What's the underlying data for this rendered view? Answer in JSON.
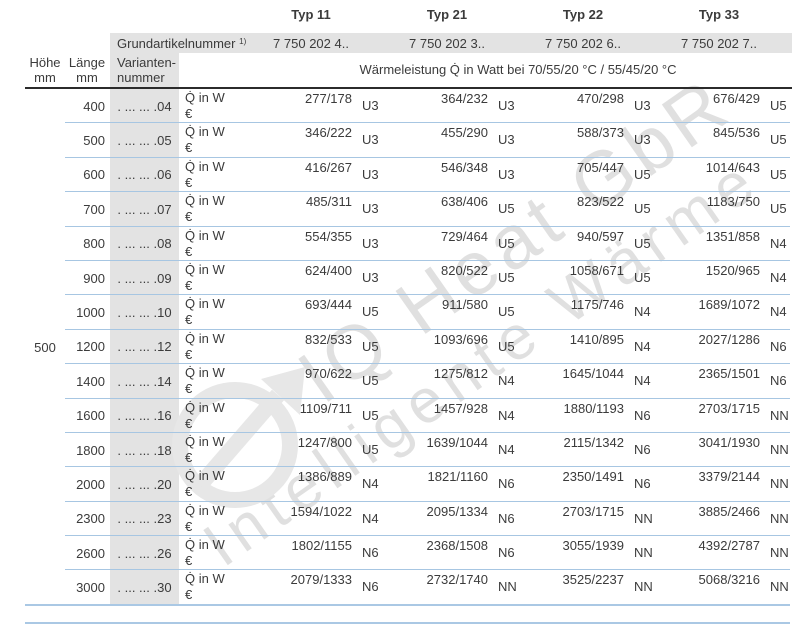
{
  "header": {
    "types": [
      "Typ 11",
      "Typ 21",
      "Typ 22",
      "Typ 33"
    ],
    "grund_label": "Grundartikelnummer",
    "grund_footnote": "1)",
    "grund_numbers": [
      "7 750 202 4..",
      "7 750 202 3..",
      "7 750 202 6..",
      "7 750 202 7.."
    ],
    "hoehe_line1": "Höhe",
    "hoehe_line2": "mm",
    "laenge_line1": "Länge",
    "laenge_line2": "mm",
    "variant_line1": "Varianten-",
    "variant_line2": "nummer",
    "performance": "Wärmeleistung Q̇ in Watt bei 70/55/20 °C / 55/45/20 °C"
  },
  "table": {
    "hoehe_value": "500",
    "q_label": "Q̇ in W",
    "euro_label": "€",
    "rows": [
      {
        "laenge": "400",
        "variant": ". ... ... .04",
        "typ11": {
          "w": "277/178",
          "code": "U3"
        },
        "typ21": {
          "w": "364/232",
          "code": "U3"
        },
        "typ22": {
          "w": "470/298",
          "code": "U3"
        },
        "typ33": {
          "w": "676/429",
          "code": "U5"
        }
      },
      {
        "laenge": "500",
        "variant": ". ... ... .05",
        "typ11": {
          "w": "346/222",
          "code": "U3"
        },
        "typ21": {
          "w": "455/290",
          "code": "U3"
        },
        "typ22": {
          "w": "588/373",
          "code": "U3"
        },
        "typ33": {
          "w": "845/536",
          "code": "U5"
        }
      },
      {
        "laenge": "600",
        "variant": ". ... ... .06",
        "typ11": {
          "w": "416/267",
          "code": "U3"
        },
        "typ21": {
          "w": "546/348",
          "code": "U3"
        },
        "typ22": {
          "w": "705/447",
          "code": "U5"
        },
        "typ33": {
          "w": "1014/643",
          "code": "U5"
        }
      },
      {
        "laenge": "700",
        "variant": ". ... ... .07",
        "typ11": {
          "w": "485/311",
          "code": "U3"
        },
        "typ21": {
          "w": "638/406",
          "code": "U5"
        },
        "typ22": {
          "w": "823/522",
          "code": "U5"
        },
        "typ33": {
          "w": "1183/750",
          "code": "U5"
        }
      },
      {
        "laenge": "800",
        "variant": ". ... ... .08",
        "typ11": {
          "w": "554/355",
          "code": "U3"
        },
        "typ21": {
          "w": "729/464",
          "code": "U5"
        },
        "typ22": {
          "w": "940/597",
          "code": "U5"
        },
        "typ33": {
          "w": "1351/858",
          "code": "N4"
        }
      },
      {
        "laenge": "900",
        "variant": ". ... ... .09",
        "typ11": {
          "w": "624/400",
          "code": "U3"
        },
        "typ21": {
          "w": "820/522",
          "code": "U5"
        },
        "typ22": {
          "w": "1058/671",
          "code": "U5"
        },
        "typ33": {
          "w": "1520/965",
          "code": "N4"
        }
      },
      {
        "laenge": "1000",
        "variant": ". ... ... .10",
        "typ11": {
          "w": "693/444",
          "code": "U5"
        },
        "typ21": {
          "w": "911/580",
          "code": "U5"
        },
        "typ22": {
          "w": "1175/746",
          "code": "N4"
        },
        "typ33": {
          "w": "1689/1072",
          "code": "N4"
        }
      },
      {
        "laenge": "1200",
        "variant": ". ... ... .12",
        "typ11": {
          "w": "832/533",
          "code": "U5"
        },
        "typ21": {
          "w": "1093/696",
          "code": "U5"
        },
        "typ22": {
          "w": "1410/895",
          "code": "N4"
        },
        "typ33": {
          "w": "2027/1286",
          "code": "N6"
        }
      },
      {
        "laenge": "1400",
        "variant": ". ... ... .14",
        "typ11": {
          "w": "970/622",
          "code": "U5"
        },
        "typ21": {
          "w": "1275/812",
          "code": "N4"
        },
        "typ22": {
          "w": "1645/1044",
          "code": "N4"
        },
        "typ33": {
          "w": "2365/1501",
          "code": "N6"
        }
      },
      {
        "laenge": "1600",
        "variant": ". ... ... .16",
        "typ11": {
          "w": "1109/711",
          "code": "U5"
        },
        "typ21": {
          "w": "1457/928",
          "code": "N4"
        },
        "typ22": {
          "w": "1880/1193",
          "code": "N6"
        },
        "typ33": {
          "w": "2703/1715",
          "code": "NN"
        }
      },
      {
        "laenge": "1800",
        "variant": ". ... ... .18",
        "typ11": {
          "w": "1247/800",
          "code": "U5"
        },
        "typ21": {
          "w": "1639/1044",
          "code": "N4"
        },
        "typ22": {
          "w": "2115/1342",
          "code": "N6"
        },
        "typ33": {
          "w": "3041/1930",
          "code": "NN"
        }
      },
      {
        "laenge": "2000",
        "variant": ". ... ... .20",
        "typ11": {
          "w": "1386/889",
          "code": "N4"
        },
        "typ21": {
          "w": "1821/1160",
          "code": "N6"
        },
        "typ22": {
          "w": "2350/1491",
          "code": "N6"
        },
        "typ33": {
          "w": "3379/2144",
          "code": "NN"
        }
      },
      {
        "laenge": "2300",
        "variant": ". ... ... .23",
        "typ11": {
          "w": "1594/1022",
          "code": "N4"
        },
        "typ21": {
          "w": "2095/1334",
          "code": "N6"
        },
        "typ22": {
          "w": "2703/1715",
          "code": "NN"
        },
        "typ33": {
          "w": "3885/2466",
          "code": "NN"
        }
      },
      {
        "laenge": "2600",
        "variant": ". ... ... .26",
        "typ11": {
          "w": "1802/1155",
          "code": "N6"
        },
        "typ21": {
          "w": "2368/1508",
          "code": "N6"
        },
        "typ22": {
          "w": "3055/1939",
          "code": "NN"
        },
        "typ33": {
          "w": "4392/2787",
          "code": "NN"
        }
      },
      {
        "laenge": "3000",
        "variant": ". ... ... .30",
        "typ11": {
          "w": "2079/1333",
          "code": "N6"
        },
        "typ21": {
          "w": "2732/1740",
          "code": "NN"
        },
        "typ22": {
          "w": "3525/2237",
          "code": "NN"
        },
        "typ33": {
          "w": "5068/3216",
          "code": "NN"
        }
      }
    ]
  },
  "watermark": {
    "line1": "IQ Heat GbR",
    "line2": "Intelligente Wärme",
    "logo": "circle-arrow"
  },
  "colors": {
    "header_gray": "#e3e3e3",
    "separator_blue": "#a7c6e2",
    "divider_black": "#2b2b2b",
    "text": "#3b3b3b",
    "watermark_gray": "#e0e0e0"
  }
}
